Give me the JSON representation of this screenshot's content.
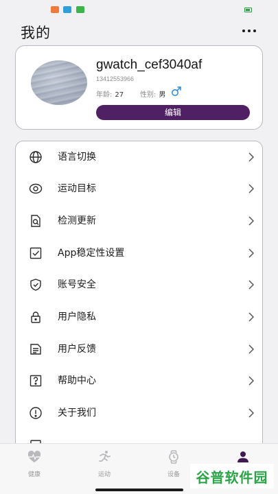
{
  "header": {
    "title": "我的",
    "more_icon": "more-horizontal-icon"
  },
  "profile": {
    "username": "gwatch_cef3040af",
    "phone": "13412553966",
    "age_label": "年龄:",
    "age_value": "27",
    "gender_label": "性别:",
    "gender_value": "男",
    "gender_icon": "male-symbol-icon",
    "edit_label": "编辑"
  },
  "menu": {
    "items": [
      {
        "label": "语言切换",
        "icon": "globe-icon"
      },
      {
        "label": "运动目标",
        "icon": "target-icon"
      },
      {
        "label": "检测更新",
        "icon": "update-search-icon"
      },
      {
        "label": "App稳定性设置",
        "icon": "checkbox-icon"
      },
      {
        "label": "账号安全",
        "icon": "shield-icon"
      },
      {
        "label": "用户隐私",
        "icon": "lock-icon"
      },
      {
        "label": "用户反馈",
        "icon": "feedback-icon"
      },
      {
        "label": "帮助中心",
        "icon": "help-icon"
      },
      {
        "label": "关于我们",
        "icon": "info-icon"
      }
    ]
  },
  "bottom_nav": {
    "items": [
      {
        "label": "健康",
        "icon": "heart-pulse-icon"
      },
      {
        "label": "运动",
        "icon": "running-icon"
      },
      {
        "label": "设备",
        "icon": "watch-icon"
      },
      {
        "label": "",
        "icon": "person-icon",
        "active": true
      }
    ]
  },
  "watermark": {
    "text": "谷普软件园"
  },
  "colors": {
    "accent": "#4f2164",
    "background": "#f1f1f3",
    "gender_icon": "#2f8fd8",
    "watermark": "#2aa446"
  }
}
